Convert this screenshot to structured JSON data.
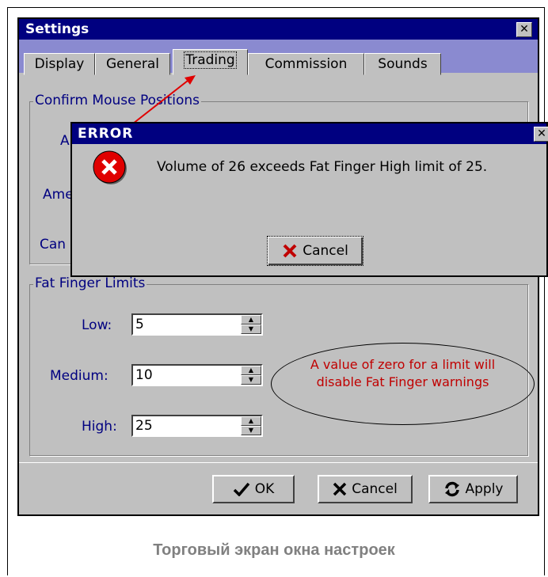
{
  "settings": {
    "title": "Settings",
    "close_glyph": "✕",
    "tabs": [
      {
        "label": "Display"
      },
      {
        "label": "General"
      },
      {
        "label": "Trading",
        "active": true
      },
      {
        "label": "Commission"
      },
      {
        "label": "Sounds"
      }
    ],
    "confirm_group": {
      "legend": "Confirm Mouse Positions",
      "row_labels": [
        "A",
        "Ame",
        "Can"
      ]
    },
    "fat_finger": {
      "legend": "Fat Finger Limits",
      "fields": [
        {
          "label": "Low:",
          "value": "5"
        },
        {
          "label": "Medium:",
          "value": "10"
        },
        {
          "label": "High:",
          "value": "25"
        }
      ]
    },
    "buttons": {
      "ok": "OK",
      "cancel": "Cancel",
      "apply": "Apply"
    }
  },
  "error_dialog": {
    "title": "ERROR",
    "message": "Volume of 26 exceeds Fat Finger High limit of 25.",
    "cancel_label": "Cancel",
    "icon": "error-icon"
  },
  "annotation": {
    "note_line1": "A value of zero for a limit will",
    "note_line2": "disable Fat Finger warnings"
  },
  "caption": "Торговый экран окна настроек",
  "colors": {
    "titlebar": "#000080",
    "face": "#c0c0c0",
    "tab_strip": "#8a8ad0",
    "annotation": "#c00000",
    "error_red": "#e00000",
    "caption": "#808080"
  }
}
